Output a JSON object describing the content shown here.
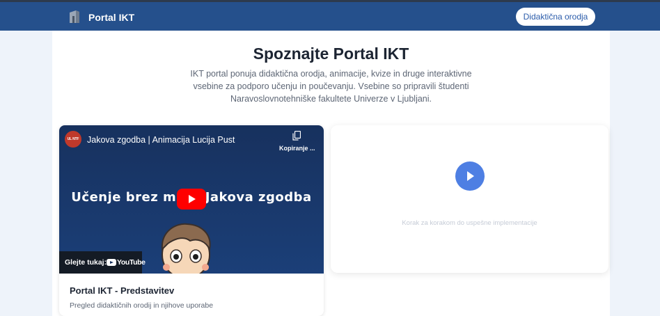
{
  "navbar": {
    "brand": "Portal IKT",
    "logo_icon": "building-icon",
    "button_label": "Didaktična orodja",
    "background_color": "#25508c"
  },
  "hero": {
    "title": "Spoznajte Portal IKT",
    "description": "IKT portal ponuja didaktična orodja, animacije, kvize in druge interaktivne vsebine za podporo učenju in poučevanju. Vsebine so pripravili študenti Naravoslovnotehniške fakultete Univerze v Ljubljani."
  },
  "video": {
    "channel_avatar": "UL NTF",
    "title": "Jakova zgodba | Animacija Lucija Pust",
    "copy_label": "Kopiranje ...",
    "headline": "Učenje brez me... Jakova zgodba",
    "watch_on": "Glejte tukaj:",
    "platform": "YouTube",
    "play_color": "#ff0000"
  },
  "video_card": {
    "title": "Portal IKT - Predstavitev",
    "description": "Pregled didaktičnih orodij in njihove uporabe"
  },
  "promo_card": {
    "text": "Korak za korakom do uspešne implementacije",
    "play_color": "#4e7fe3"
  }
}
